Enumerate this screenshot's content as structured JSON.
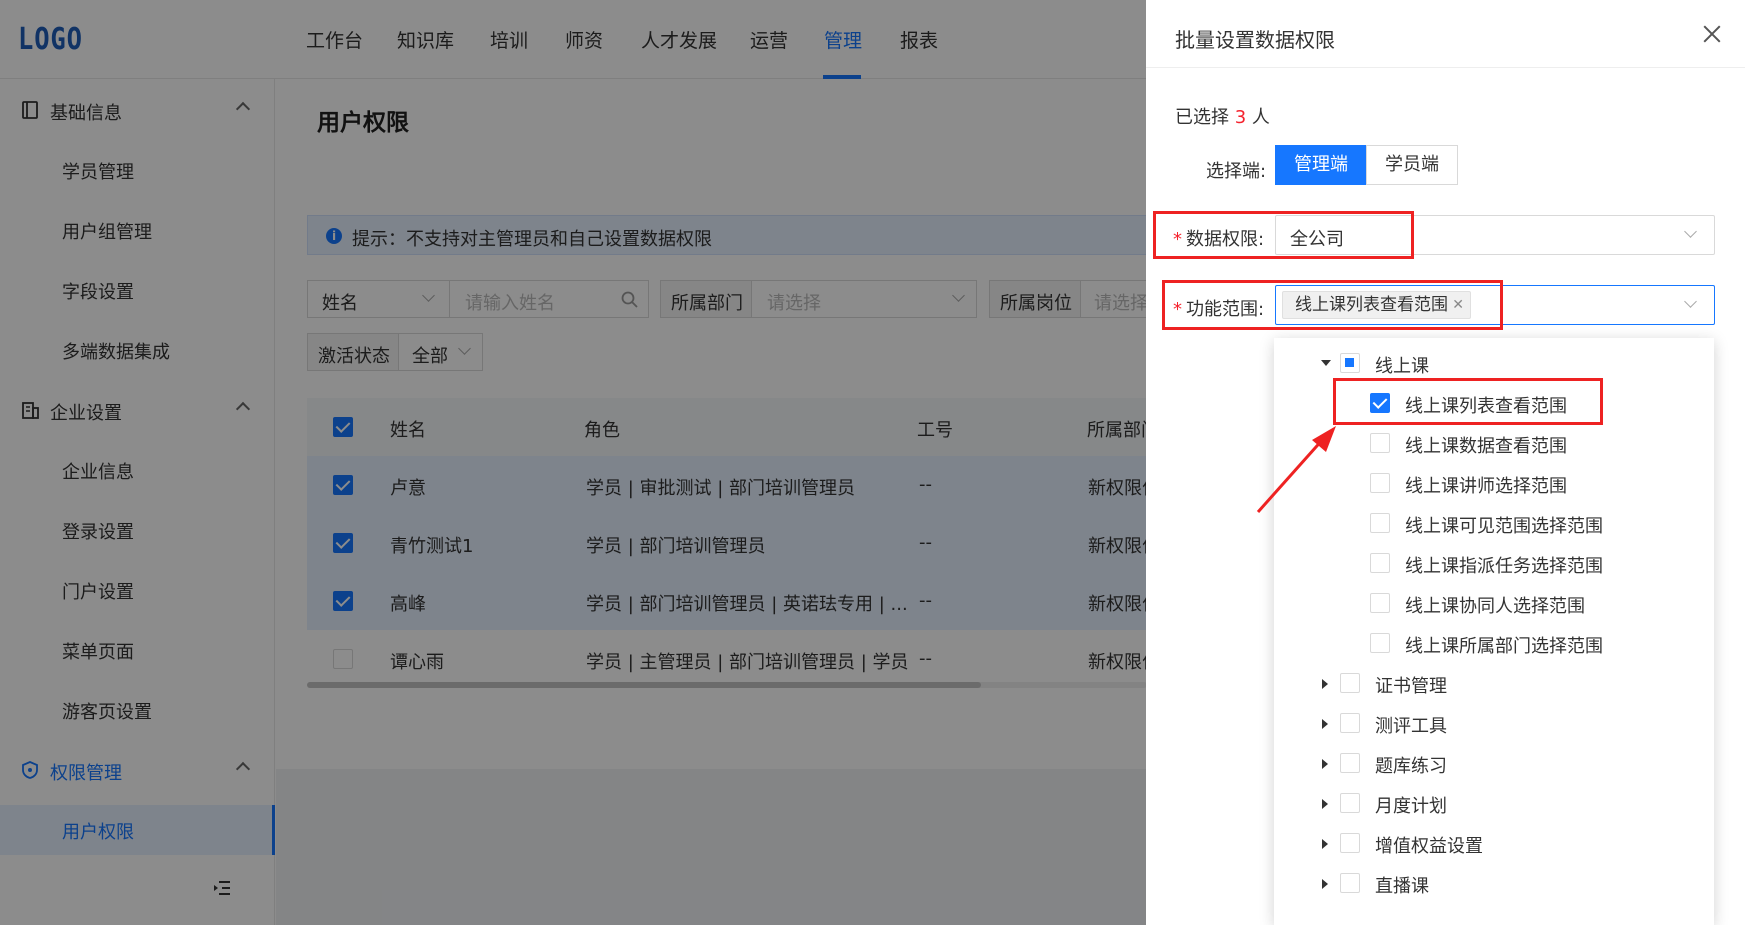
{
  "header": {
    "logo": "LOGO",
    "nav": [
      {
        "label": "工作台",
        "active": false
      },
      {
        "label": "知识库",
        "active": false
      },
      {
        "label": "培训",
        "active": false
      },
      {
        "label": "师资",
        "active": false
      },
      {
        "label": "人才发展",
        "active": false
      },
      {
        "label": "运营",
        "active": false
      },
      {
        "label": "管理",
        "active": true
      },
      {
        "label": "报表",
        "active": false
      }
    ]
  },
  "sidebar": {
    "groups": [
      {
        "label": "基础信息",
        "icon": "book-icon",
        "items": [
          "学员管理",
          "用户组管理",
          "字段设置",
          "多端数据集成"
        ]
      },
      {
        "label": "企业设置",
        "icon": "building-icon",
        "items": [
          "企业信息",
          "登录设置",
          "门户设置",
          "菜单页面",
          "游客页设置"
        ]
      },
      {
        "label": "权限管理",
        "icon": "shield-icon",
        "items": [
          "用户权限"
        ]
      }
    ],
    "active_item": "用户权限",
    "collapse_icon": "menu-fold-icon"
  },
  "main": {
    "title": "用户权限",
    "tip": "提示：不支持对主管理员和自己设置数据权限",
    "filters": {
      "name_field": "姓名",
      "name_placeholder": "请输入姓名",
      "dept_label": "所属部门",
      "dept_placeholder": "请选择",
      "post_label": "所属岗位",
      "post_placeholder": "请选择",
      "status_label": "激活状态",
      "status_value": "全部"
    },
    "table": {
      "columns": [
        "姓名",
        "角色",
        "工号",
        "所属部门"
      ],
      "rows": [
        {
          "name": "卢意",
          "role": "学员 | 审批测试 | 部门培训管理员",
          "id": "--",
          "dept": "新权限位",
          "checked": true
        },
        {
          "name": "青竹测试1",
          "role": "学员 | 部门培训管理员",
          "id": "--",
          "dept": "新权限位",
          "checked": true
        },
        {
          "name": "高峰",
          "role": "学员 | 部门培训管理员 | 英诺珐专用 | ...",
          "id": "--",
          "dept": "新权限位",
          "checked": true
        },
        {
          "name": "谭心雨",
          "role": "学员 | 主管理员 | 部门培训管理员 | 学员",
          "id": "--",
          "dept": "新权限位",
          "checked": false
        }
      ]
    }
  },
  "drawer": {
    "title": "批量设置数据权限",
    "selected_prefix": "已选择 ",
    "selected_count": "3",
    "selected_suffix": " 人",
    "terminal_label": "选择端:",
    "terminals": [
      {
        "label": "管理端",
        "active": true
      },
      {
        "label": "学员端",
        "active": false
      }
    ],
    "data_scope_label": "数据权限:",
    "data_scope_value": "全公司",
    "func_scope_label": "功能范围:",
    "func_scope_tag": "线上课列表查看范围",
    "tree": [
      {
        "label": "线上课",
        "level": 0,
        "expanded": true,
        "state": "half"
      },
      {
        "label": "线上课列表查看范围",
        "level": 1,
        "state": "checked"
      },
      {
        "label": "线上课数据查看范围",
        "level": 1,
        "state": "unchecked"
      },
      {
        "label": "线上课讲师选择范围",
        "level": 1,
        "state": "unchecked"
      },
      {
        "label": "线上课可见范围选择范围",
        "level": 1,
        "state": "unchecked"
      },
      {
        "label": "线上课指派任务选择范围",
        "level": 1,
        "state": "unchecked"
      },
      {
        "label": "线上课协同人选择范围",
        "level": 1,
        "state": "unchecked"
      },
      {
        "label": "线上课所属部门选择范围",
        "level": 1,
        "state": "unchecked"
      },
      {
        "label": "证书管理",
        "level": 0,
        "expanded": false,
        "state": "unchecked"
      },
      {
        "label": "测评工具",
        "level": 0,
        "expanded": false,
        "state": "unchecked"
      },
      {
        "label": "题库练习",
        "level": 0,
        "expanded": false,
        "state": "unchecked"
      },
      {
        "label": "月度计划",
        "level": 0,
        "expanded": false,
        "state": "unchecked"
      },
      {
        "label": "增值权益设置",
        "level": 0,
        "expanded": false,
        "state": "unchecked"
      },
      {
        "label": "直播课",
        "level": 0,
        "expanded": false,
        "state": "unchecked"
      }
    ],
    "colors": {
      "accent": "#1677ff",
      "required": "#f5222d",
      "highlight": "#ee2222"
    }
  }
}
